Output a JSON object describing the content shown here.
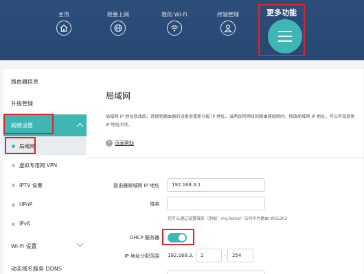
{
  "nav": {
    "items": [
      {
        "label": "主页",
        "icon": "home-icon"
      },
      {
        "label": "我要上网",
        "icon": "globe-icon"
      },
      {
        "label": "我的 Wi-Fi",
        "icon": "wifi-icon"
      },
      {
        "label": "终端管理",
        "icon": "user-icon"
      }
    ],
    "more": {
      "label": "更多功能",
      "icon": "menu-icon"
    }
  },
  "sidebar": {
    "items": [
      {
        "label": "路由器信息"
      },
      {
        "label": "升级管理"
      },
      {
        "label": "网络设置"
      },
      {
        "label": "Wi-Fi 设置"
      },
      {
        "label": "动态域名服务 DDNS"
      }
    ],
    "sub_items": [
      {
        "label": "局域网"
      },
      {
        "label": "虚拟专用网 VPN"
      },
      {
        "label": "IPTV 设置"
      },
      {
        "label": "UPnP"
      },
      {
        "label": "IPv6"
      }
    ]
  },
  "main": {
    "title": "局域网",
    "description": "局域网 IP 地址修改后，连接到路由器的设备会重新分配 IP 地址。当两台同网段的路由器组网时，修改局域网 IP 地址，可以有效避免 IP 地址冲突。",
    "help_label": "页面帮助",
    "help_icon": "question-icon",
    "form": {
      "ip_label": "路由器局域网 IP 地址",
      "ip_value": "192.168.3.1",
      "domain_label": "域名",
      "domain_value": "",
      "domain_hint": "您可以通过设置域名（例如：my.home）访问华为路由 WS5202",
      "dhcp_label": "DHCP 服务器",
      "dhcp_enabled": true,
      "range_label": "IP 地址分配范围",
      "range_prefix": "192.168.3.",
      "range_start": "2",
      "range_sep": "-",
      "range_end": "254"
    }
  },
  "colors": {
    "header": "#2d4e7a",
    "accent": "#3fb5b4",
    "highlight_box": "#d9262a"
  }
}
